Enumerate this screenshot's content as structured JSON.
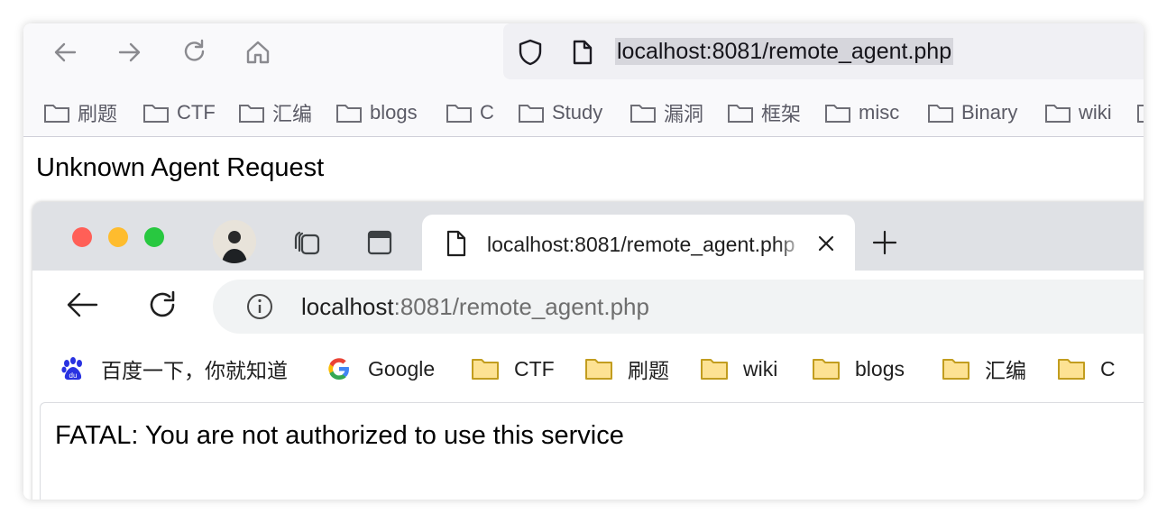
{
  "outer_browser": {
    "nav": {
      "back_icon": "arrow-left-icon",
      "forward_icon": "arrow-right-icon",
      "reload_icon": "reload-icon",
      "home_icon": "home-icon"
    },
    "url": "localhost:8081/remote_agent.php",
    "bookmarks": [
      "刷题",
      "CTF",
      "汇编",
      "blogs",
      "C",
      "Study",
      "漏洞",
      "框架",
      "misc",
      "Binary",
      "wiki"
    ]
  },
  "page": {
    "heading": "Unknown Agent Request"
  },
  "inner_browser": {
    "tab": {
      "title": "localhost:8081/remote_agent.php"
    },
    "url": {
      "host": "localhost",
      "rest": ":8081/remote_agent.php"
    },
    "bookmarks": [
      {
        "label": "百度一下，你就知道",
        "icon": "baidu-icon"
      },
      {
        "label": "Google",
        "icon": "google-icon"
      },
      {
        "label": "CTF",
        "icon": "folder-icon"
      },
      {
        "label": "刷题",
        "icon": "folder-icon"
      },
      {
        "label": "wiki",
        "icon": "folder-icon"
      },
      {
        "label": "blogs",
        "icon": "folder-icon"
      },
      {
        "label": "汇编",
        "icon": "folder-icon"
      },
      {
        "label": "C",
        "icon": "folder-icon"
      }
    ],
    "content": "FATAL: You are not authorized to use this service"
  },
  "colors": {
    "traffic_red": "#ff5f57",
    "traffic_yellow": "#febc2e",
    "traffic_green": "#28c840",
    "folder_fill": "#fde293",
    "folder_stroke": "#c29d1f"
  }
}
